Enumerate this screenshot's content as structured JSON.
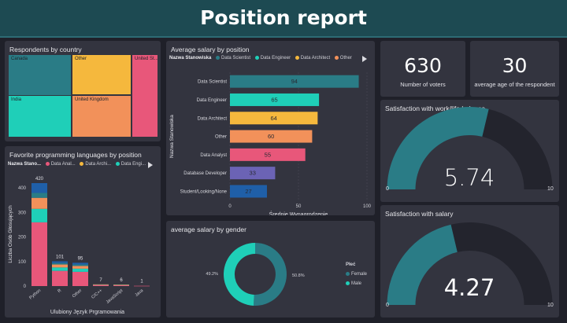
{
  "header": {
    "title": "Position report"
  },
  "respondents": {
    "title": "Respondents by country",
    "cells": [
      {
        "label": "Canada",
        "color": "#2a7c86"
      },
      {
        "label": "Other",
        "color": "#f5b83d"
      },
      {
        "label": "United St...",
        "color": "#e8577a"
      },
      {
        "label": "India",
        "color": "#1fcfb8"
      },
      {
        "label": "United Kingdom",
        "color": "#f2915a"
      }
    ]
  },
  "salary_position": {
    "title": "Average salary by position",
    "legend_title": "Nazwa Stanowiska",
    "legend": [
      {
        "label": "Data Scientist",
        "color": "#2a7c86"
      },
      {
        "label": "Data Engineer",
        "color": "#1fcfb8"
      },
      {
        "label": "Data Architect",
        "color": "#f5b83d"
      },
      {
        "label": "Other",
        "color": "#f2915a"
      }
    ],
    "ylabel": "Nazwa Stanowiska",
    "xlabel": "Średnie Wynagrodzenie"
  },
  "kpi_voters": {
    "value": "630",
    "label": "Number of voters"
  },
  "kpi_age": {
    "value": "30",
    "label": "average age of the respondent"
  },
  "worklife": {
    "title": "Satisfaction with work/life balance",
    "value": "5.74",
    "min": "0",
    "max": "10",
    "fraction": 0.574
  },
  "satisfaction_salary": {
    "title": "Satisfaction with salary",
    "value": "4.27",
    "min": "0",
    "max": "10",
    "fraction": 0.427
  },
  "languages": {
    "title": "Favorite programming languages by position",
    "legend_title": "Nazwa Stano...",
    "legend": [
      {
        "label": "Data Anal...",
        "color": "#e8577a"
      },
      {
        "label": "Data Archi...",
        "color": "#f5b83d"
      },
      {
        "label": "Data Engi...",
        "color": "#1fcfb8"
      }
    ],
    "ylabel": "Liczba Osób Głosujących",
    "xlabel": "Ulubiony Język Prgramowania"
  },
  "gender": {
    "title": "average salary by gender",
    "legend_title": "Płeć",
    "legend": [
      {
        "label": "Female",
        "color": "#2a7c86"
      },
      {
        "label": "Male",
        "color": "#1fcfb8"
      }
    ]
  },
  "chart_data": [
    {
      "type": "bar",
      "title": "Average salary by position",
      "orientation": "horizontal",
      "categories": [
        "Data Scientist",
        "Data Engineer",
        "Data Architect",
        "Other",
        "Data Analyst",
        "Database Developer",
        "Student/Looking/None"
      ],
      "values": [
        94,
        65,
        64,
        60,
        55,
        33,
        27
      ],
      "colors": [
        "#2a7c86",
        "#1fcfb8",
        "#f5b83d",
        "#f2915a",
        "#e8577a",
        "#6b63b5",
        "#1f5fa8"
      ],
      "xlabel": "Średnie Wynagrodzenie",
      "ylabel": "Nazwa Stanowiska",
      "xticks": [
        "0",
        "50",
        "100"
      ],
      "xlim": [
        0,
        100
      ]
    },
    {
      "type": "bar",
      "title": "Favorite programming languages by position",
      "stacked": true,
      "categories": [
        "Python",
        "R",
        "Other",
        "C/C++",
        "JavaScript",
        "Java"
      ],
      "totals": [
        "420",
        "101",
        "95",
        "7",
        "6",
        "1"
      ],
      "series": [
        {
          "name": "Data Anal...",
          "color": "#e8577a",
          "values": [
            260,
            62,
            58,
            5,
            4,
            1
          ]
        },
        {
          "name": "Data Archi...",
          "color": "#f5b83d",
          "values": [
            0,
            0,
            0,
            0,
            0,
            0
          ]
        },
        {
          "name": "Data Engi...",
          "color": "#1fcfb8",
          "values": [
            55,
            14,
            13,
            1,
            1,
            0
          ]
        },
        {
          "color": "#f2915a",
          "values": [
            45,
            12,
            11,
            1,
            1,
            0
          ]
        },
        {
          "color": "#2a7c86",
          "values": [
            20,
            6,
            6,
            0,
            0,
            0
          ]
        },
        {
          "color": "#1f5fa8",
          "values": [
            40,
            7,
            7,
            0,
            0,
            0
          ]
        }
      ],
      "yticks": [
        "0",
        "100",
        "200",
        "300",
        "400"
      ],
      "ylim": [
        0,
        420
      ],
      "xlabel": "Ulubiony Język Prgramowania",
      "ylabel": "Liczba Osób Głosujących"
    },
    {
      "type": "pie",
      "title": "average salary by gender",
      "donut": true,
      "labels": [
        "Female",
        "Male"
      ],
      "values": [
        50.8,
        49.2
      ],
      "value_labels": [
        "50.8%",
        "49.2%"
      ],
      "colors": [
        "#2a7c86",
        "#1fcfb8"
      ]
    }
  ]
}
